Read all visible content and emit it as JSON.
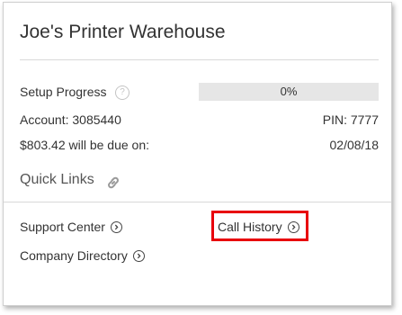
{
  "card": {
    "title": "Joe's Printer Warehouse",
    "setup_progress": {
      "label": "Setup Progress",
      "help_icon": "question-mark-icon",
      "value_text": "0%",
      "value": 0
    },
    "account": {
      "label": "Account: 3085440",
      "pin": "PIN: 7777"
    },
    "due": {
      "label": "$803.42 will be due on:",
      "date": "02/08/18"
    },
    "quick_links": {
      "title": "Quick Links",
      "icon": "link-icon",
      "items": [
        {
          "label": "Support Center",
          "icon": "chevron-right-circle-icon"
        },
        {
          "label": "Call History",
          "icon": "chevron-right-circle-icon",
          "highlighted": true
        },
        {
          "label": "Company Directory",
          "icon": "chevron-right-circle-icon"
        }
      ]
    }
  },
  "colors": {
    "highlight_border": "#e8000b",
    "progress_track": "#e6e6e6",
    "divider": "#d9d9d9",
    "text": "#333333"
  }
}
